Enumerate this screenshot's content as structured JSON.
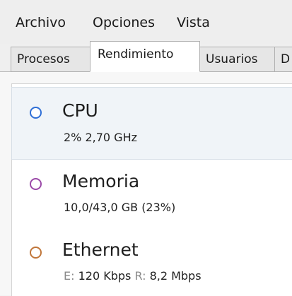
{
  "menu": {
    "items": [
      "Archivo",
      "Opciones",
      "Vista"
    ]
  },
  "tabs": {
    "items": [
      "Procesos",
      "Rendimiento",
      "Usuarios",
      "D"
    ],
    "active_index": 1
  },
  "sidebar": {
    "items": [
      {
        "title": "CPU",
        "detail": "2% 2,70 GHz",
        "color": "#2f6fd6",
        "selected": true
      },
      {
        "title": "Memoria",
        "detail": "10,0/43,0 GB (23%)",
        "color": "#9b4aa8",
        "selected": false
      },
      {
        "title": "Ethernet",
        "send_prefix": "E:",
        "send_value": "120 Kbps",
        "recv_prefix": "R:",
        "recv_value": "8,2 Mbps",
        "color": "#c0763a",
        "selected": false
      }
    ]
  },
  "colors": {
    "background": "#f3f3f3",
    "panel": "#ffffff",
    "selection": "#f0f4f8"
  }
}
